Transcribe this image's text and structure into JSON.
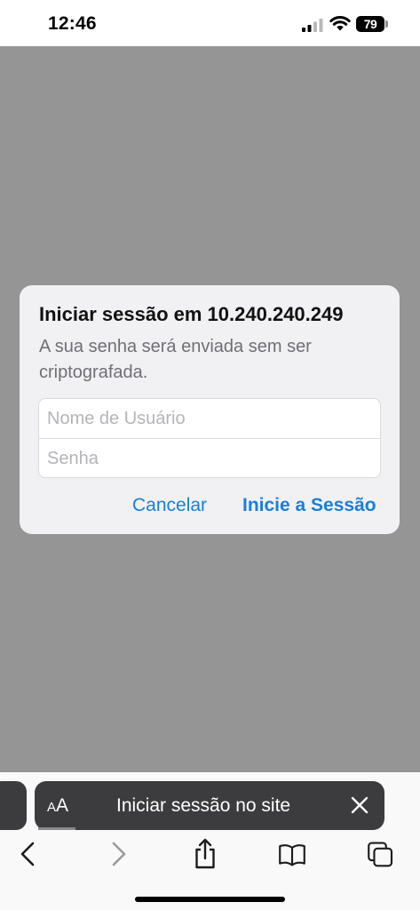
{
  "status_bar": {
    "time": "12:46",
    "battery": "79"
  },
  "dialog": {
    "title": "Iniciar sessão em 10.240.240.249",
    "message": "A sua senha será enviada sem ser criptografada.",
    "username_placeholder": "Nome de Usuário",
    "password_placeholder": "Senha",
    "cancel_label": "Cancelar",
    "login_label": "Inicie a Sessão",
    "accent_color": "#1a7fd8"
  },
  "toolbar": {
    "aa_small": "A",
    "aa_big": "A",
    "address_text": "Iniciar sessão no site",
    "icons": [
      "back-icon",
      "forward-icon",
      "share-icon",
      "bookmarks-icon",
      "tabs-icon",
      "close-icon"
    ]
  },
  "colors": {
    "overlay": "#959595",
    "toolbar_pill": "#3c3c3e"
  }
}
